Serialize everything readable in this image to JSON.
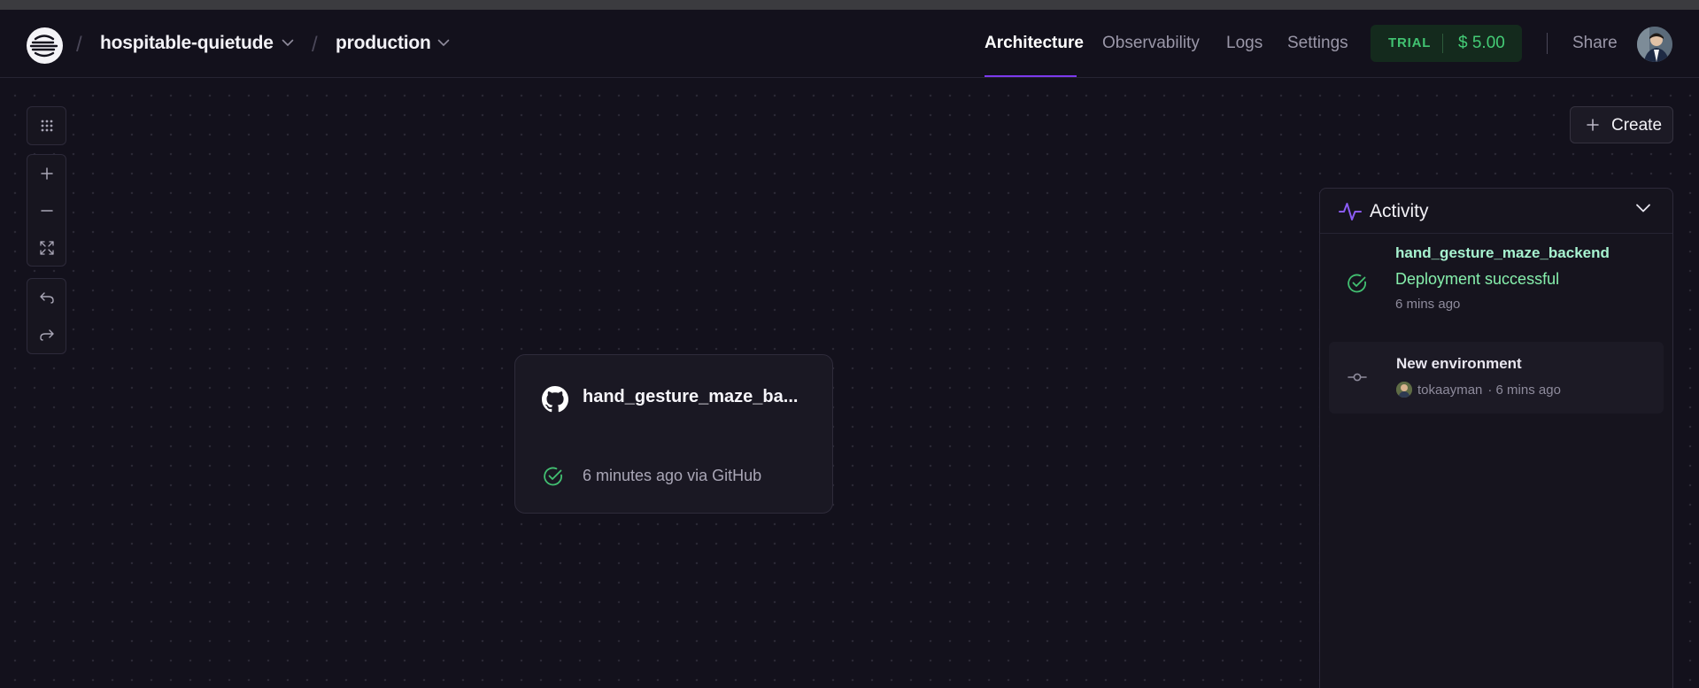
{
  "header": {
    "project": "hospitable-quietude",
    "environment": "production",
    "nav": [
      {
        "label": "Architecture",
        "active": true
      },
      {
        "label": "Observability",
        "active": false
      },
      {
        "label": "Logs",
        "active": false
      },
      {
        "label": "Settings",
        "active": false
      }
    ],
    "plan": {
      "label": "TRIAL",
      "credit": "$ 5.00"
    },
    "share_label": "Share"
  },
  "toolbar": {
    "icons": [
      "grid-icon",
      "zoom-in-icon",
      "zoom-out-icon",
      "fit-view-icon",
      "undo-icon",
      "redo-icon"
    ]
  },
  "create_label": "Create",
  "service": {
    "name": "hand_gesture_maze_ba...",
    "status": "6 minutes ago via GitHub",
    "status_color": "#4ade80"
  },
  "activity": {
    "title": "Activity",
    "items": [
      {
        "service": "hand_gesture_maze_backend",
        "message": "Deployment successful",
        "time": "6 mins ago"
      },
      {
        "title": "New environment",
        "user": "tokaayman",
        "time": "· 6 mins ago"
      }
    ]
  },
  "colors": {
    "background": "#13111c",
    "accent": "#7c3aed",
    "success": "#4ade80"
  }
}
